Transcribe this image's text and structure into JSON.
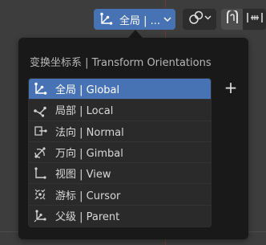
{
  "header": {
    "orientation_dropdown": {
      "label": "全局 | ...",
      "icon": "transform-axes-icon"
    },
    "snap_dropdown": {
      "icon": "snap-link-icon"
    },
    "magnet_button": {
      "icon": "magnet-icon"
    },
    "snap_increment_button": {
      "icon": "snap-increment-icon"
    }
  },
  "popup": {
    "title": "变换坐标系 | Transform Orientations",
    "add_label": "+",
    "items": [
      {
        "label": "全局 | Global",
        "icon": "global-axes-icon",
        "selected": true
      },
      {
        "label": "局部 | Local",
        "icon": "local-axes-icon",
        "selected": false
      },
      {
        "label": "法向 | Normal",
        "icon": "normal-icon",
        "selected": false
      },
      {
        "label": "万向 | Gimbal",
        "icon": "gimbal-icon",
        "selected": false
      },
      {
        "label": "视图 | View",
        "icon": "view-axes-icon",
        "selected": false
      },
      {
        "label": "游标 | Cursor",
        "icon": "cursor-icon",
        "selected": false
      },
      {
        "label": "父级 | Parent",
        "icon": "parent-icon",
        "selected": false
      }
    ]
  },
  "colors": {
    "accent": "#4772b3",
    "popup_bg": "#191919",
    "viewport_bg": "#3d3d3d"
  }
}
